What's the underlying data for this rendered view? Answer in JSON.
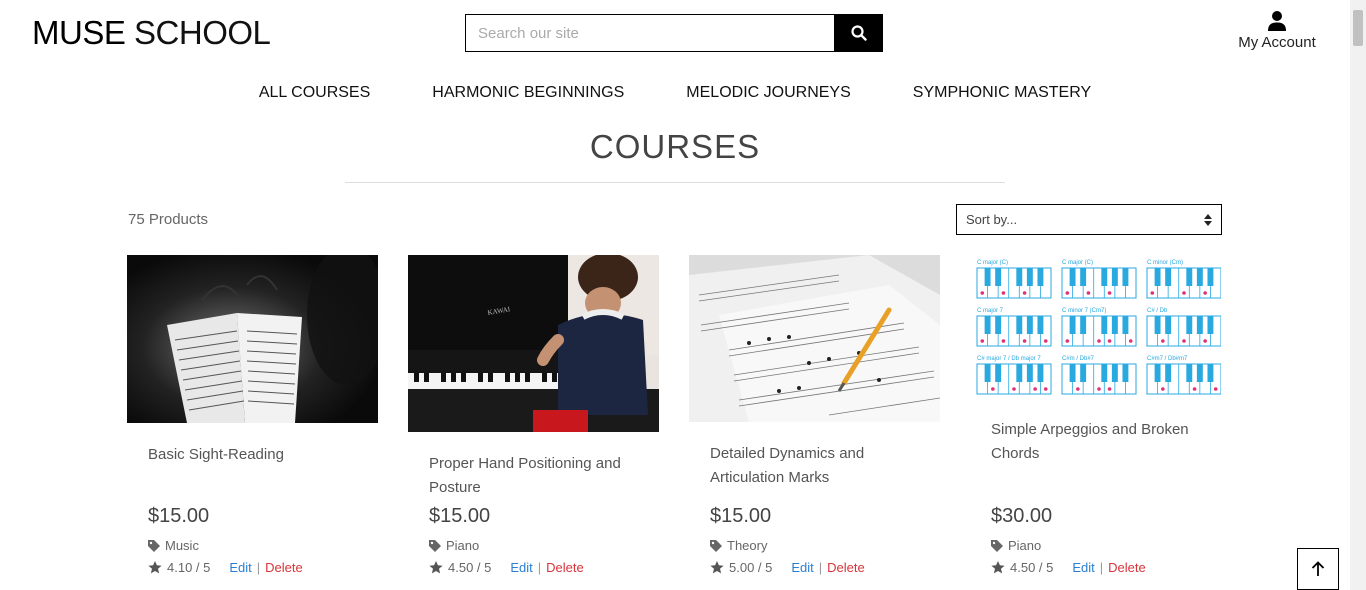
{
  "brand": {
    "word1": "MUSE",
    "word2": "SCHOOL"
  },
  "search": {
    "placeholder": "Search our site"
  },
  "account": {
    "label": "My Account"
  },
  "nav": [
    "ALL COURSES",
    "HARMONIC BEGINNINGS",
    "MELODIC JOURNEYS",
    "SYMPHONIC MASTERY"
  ],
  "page": {
    "title": "COURSES",
    "product_count": "75 Products",
    "sort_label": "Sort by..."
  },
  "products": [
    {
      "title": "Basic Sight-Reading",
      "price": "$15.00",
      "category": "Music",
      "rating": "4.10 / 5",
      "edit": "Edit",
      "sep": "|",
      "delete": "Delete"
    },
    {
      "title": "Proper Hand Positioning and Posture",
      "price": "$15.00",
      "category": "Piano",
      "rating": "4.50 / 5",
      "edit": "Edit",
      "sep": "|",
      "delete": "Delete"
    },
    {
      "title": "Detailed Dynamics and Articulation Marks",
      "price": "$15.00",
      "category": "Theory",
      "rating": "5.00 / 5",
      "edit": "Edit",
      "sep": "|",
      "delete": "Delete"
    },
    {
      "title": "Simple Arpeggios and Broken Chords",
      "price": "$30.00",
      "category": "Piano",
      "rating": "4.50 / 5",
      "edit": "Edit",
      "sep": "|",
      "delete": "Delete"
    }
  ],
  "chord_labels": [
    "C major (C)",
    "C major (C)",
    "C minor (Cm)",
    "C major 7",
    "C minor 7 (Cm7)",
    "C# / Db",
    "C# major 7 / Db major 7",
    "C#m / Db#7",
    "C#m7 / Db#m7"
  ],
  "colors": {
    "accent_link": "#2a7fd4",
    "delete": "#d9343a",
    "key_blue": "#29a9e0",
    "dot_pink": "#e0307a"
  }
}
